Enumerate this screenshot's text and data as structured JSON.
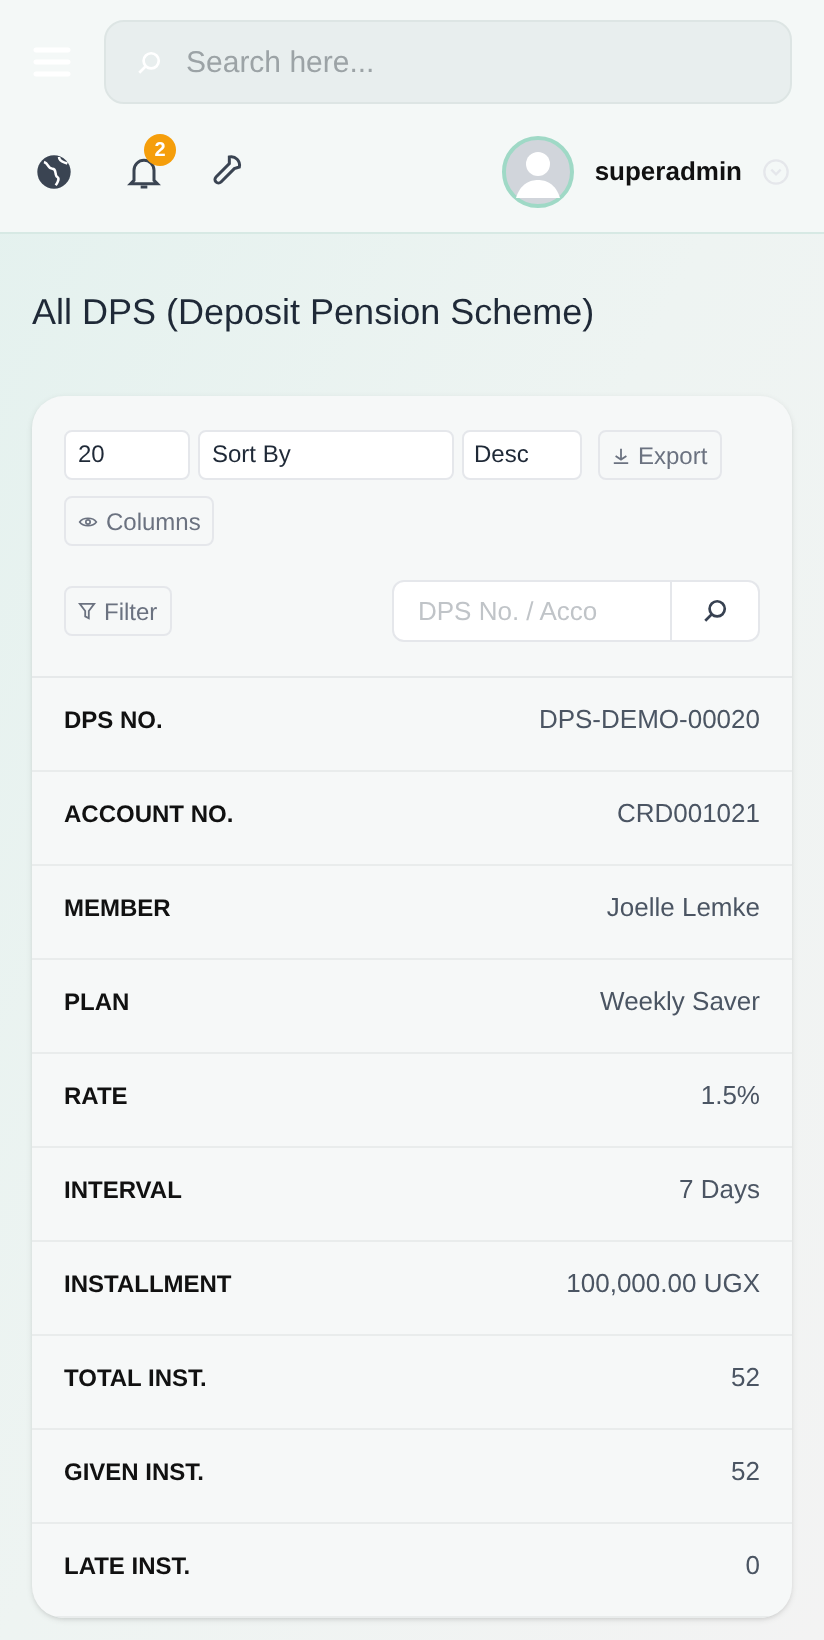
{
  "header": {
    "search": {
      "placeholder": "Search here..."
    },
    "notifications": {
      "count": "2"
    },
    "user": {
      "name": "superadmin"
    }
  },
  "page": {
    "title": "All DPS (Deposit Pension Scheme)"
  },
  "toolbar": {
    "per_page": "20",
    "sort_by": "Sort By",
    "order": "Desc",
    "export": "Export",
    "columns": "Columns",
    "filter": "Filter",
    "search_placeholder": "DPS No. / Acco"
  },
  "details": [
    {
      "label": "DPS NO.",
      "value": "DPS-DEMO-00020"
    },
    {
      "label": "ACCOUNT NO.",
      "value": "CRD001021"
    },
    {
      "label": "MEMBER",
      "value": "Joelle Lemke"
    },
    {
      "label": "PLAN",
      "value": "Weekly Saver"
    },
    {
      "label": "RATE",
      "value": "1.5%"
    },
    {
      "label": "INTERVAL",
      "value": "7 Days"
    },
    {
      "label": "INSTALLMENT",
      "value": "100,000.00 UGX"
    },
    {
      "label": "TOTAL INST.",
      "value": "52"
    },
    {
      "label": "GIVEN INST.",
      "value": "52"
    },
    {
      "label": "LATE INST.",
      "value": "0"
    }
  ]
}
